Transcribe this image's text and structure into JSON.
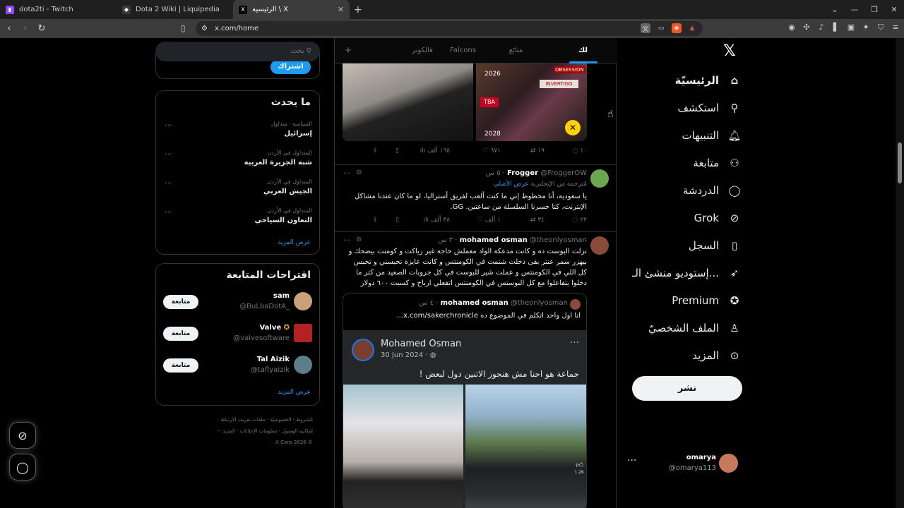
{
  "browser": {
    "tabs": [
      {
        "title": "dota2ti - Twitch",
        "favicon_color": "#9146ff",
        "active": false
      },
      {
        "title": "Dota 2 Wiki | Liquipedia",
        "favicon_color": "#3b3b3b",
        "active": false
      },
      {
        "title": "الرئيسية \\ X",
        "favicon_color": "#000000",
        "active": true
      }
    ],
    "url": "x.com/home"
  },
  "feed": {
    "tabs": [
      "لك",
      "متابَع",
      "Falcons",
      "فالكونز"
    ],
    "post_top": {
      "replies": "١٠",
      "reposts": "١٩",
      "likes": "٦٧١",
      "views": "١٦٥ ألف",
      "image_texts": {
        "tba": "TBA",
        "invertigo": "INVERTIGO",
        "obsession": "OBSESSION",
        "year_a": "2026",
        "year_b": "2028"
      }
    },
    "post_frogger": {
      "name": "Frogger",
      "handle": "@FroggerOW",
      "time": "٥ س",
      "translated_label": "مُترجمة من الإنجليزية",
      "show_original": "عرض الأصلي",
      "text": "يا سعودية، أنا محظوظ إني ما كنت ألعب لفريق أستراليا، لو ما كان عندنا مشاكل الإنترنت، كنا خسرنا السلسلة من ساعتين. GG.",
      "replies": "٢٢",
      "reposts": "٣٤",
      "likes": "١ ألف",
      "views": "٣٨ ألف"
    },
    "post_osman": {
      "name": "mohamed osman",
      "handle": "@theonlyosman",
      "time": "٣ س",
      "text": "نزلت البوست ده و كانت مدعكة الواد معملش حاجة غير رياكت و كومنت بيضحك و بيهزر سمر عنتر بقى دخلت شتمت في الكومنتس و كانت عايزة تحبسني و تحبس كل اللي في الكومنتس و عملت شير للبوست في كل جروبات الصعيد من كتر ما دخلوا يتفاعلوا مع كل البوستس في الكومنتس اتفعلي ارباح و كسبت ٦٠٠ دولار",
      "quote": {
        "name": "mohamed osman",
        "handle": "@theonlyosman",
        "time": "٤ س",
        "text": "انا اول واحد اتكلم في الموضوع ده  x.com/sakerchronicle...",
        "fb_name": "Mohamed Osman",
        "fb_date": "30 Jun 2024 ·",
        "fb_text": "جماعة هو احنا مش هنجوز الاتنين دول لبعض !",
        "reaction_count": "1.2K"
      }
    }
  },
  "sidebar_left": {
    "search_placeholder": "بحث",
    "subscribe_label": "اشتراك",
    "trends_title": "ما يحدث",
    "trends": [
      {
        "category": "السياسة · متداول",
        "name": "إسرائيل"
      },
      {
        "category": "المتداول في الأردن",
        "name": "شبه الجزيرة العربية"
      },
      {
        "category": "المتداول في الأردن",
        "name": "الجيش العربي"
      },
      {
        "category": "المتداول في الأردن",
        "name": "التعاون السياحي"
      }
    ],
    "show_more": "عرض المزيد",
    "suggest_title": "اقتراحات المتابعة",
    "suggestions": [
      {
        "name": "sam",
        "handle": "@BuLbaDotA_",
        "follow": "متابعة",
        "avatar_color": "#c9a27a"
      },
      {
        "name": "Valve",
        "handle": "@valvesoftware",
        "follow": "متابعة",
        "avatar_color": "#b22222"
      },
      {
        "name": "Tal Aizik",
        "handle": "@taflyaizik",
        "follow": "متابعة",
        "avatar_color": "#5f7c8a"
      }
    ],
    "footer": [
      "الشروط",
      "الخصوصيّة",
      "ملفات تعريف الارتباط",
      "إمكانية الوصول",
      "معلومات الإعلانات",
      "المزيد ···",
      "© 2026 X Corp."
    ]
  },
  "sidebar_right": {
    "nav": [
      {
        "label": "الرئيسيّة",
        "icon": "home-icon",
        "glyph": "⌂"
      },
      {
        "label": "استكشف",
        "icon": "search-icon",
        "glyph": "⌕"
      },
      {
        "label": "التنبيهات",
        "icon": "bell-icon",
        "glyph": "♫"
      },
      {
        "label": "متابعة",
        "icon": "person-add-icon",
        "glyph": "⚇"
      },
      {
        "label": "الدردشة",
        "icon": "chat-icon",
        "glyph": "◯"
      },
      {
        "label": "Grok",
        "icon": "grok-icon",
        "glyph": "⊘"
      },
      {
        "label": "السجل",
        "icon": "bookmark-icon",
        "glyph": "▯"
      },
      {
        "label": "إستوديو منشئ الـ...",
        "icon": "rocket-icon",
        "glyph": "➤"
      },
      {
        "label": "Premium",
        "icon": "verified-icon",
        "glyph": "✪"
      },
      {
        "label": "الملف الشخصيّ",
        "icon": "profile-icon",
        "glyph": "♙"
      },
      {
        "label": "المزيد",
        "icon": "more-icon",
        "glyph": "⋯"
      }
    ],
    "post_button": "نشر",
    "user_name": "omarya",
    "user_handle": "@omarya113"
  },
  "colors": {
    "accent": "#1d9bf0",
    "bg": "#000000",
    "border": "#2f3336"
  }
}
